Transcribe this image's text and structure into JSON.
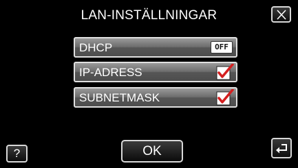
{
  "header": {
    "title": "LAN-INSTÄLLNINGAR",
    "close_icon": "close-icon"
  },
  "settings": [
    {
      "label": "DHCP",
      "state": "off",
      "badge_text": "OFF"
    },
    {
      "label": "IP-ADRESS",
      "state": "checked",
      "icon": "checkmark-icon"
    },
    {
      "label": "SUBNETMASK",
      "state": "checked",
      "icon": "checkmark-icon"
    }
  ],
  "footer": {
    "help_label": "?",
    "ok_label": "OK",
    "back_icon": "return-arrow-icon"
  },
  "colors": {
    "background": "#000000",
    "row_border": "#e0e0e0",
    "check_red": "#d42020"
  }
}
